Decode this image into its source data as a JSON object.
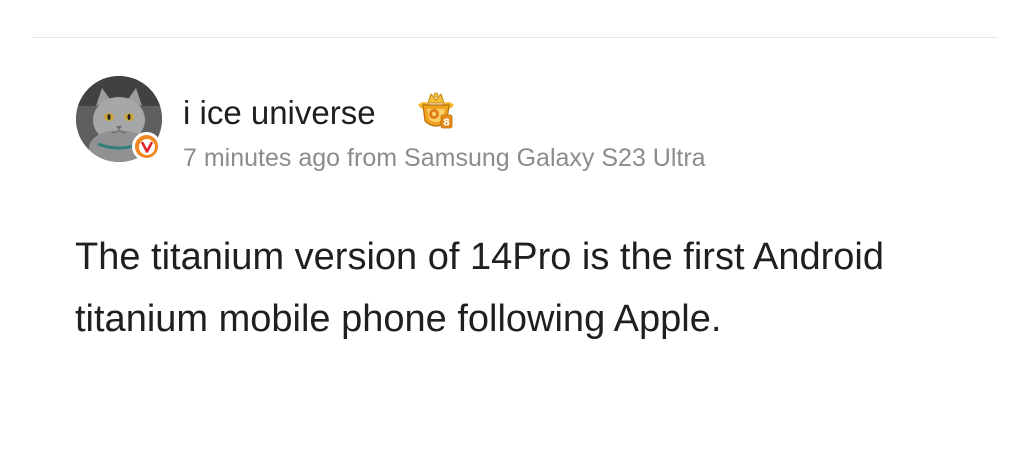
{
  "post": {
    "author": {
      "name": "i ice universe",
      "avatar_icon": "cat-avatar-icon",
      "badge_icon": "verified-v-icon",
      "badge_letter": "V",
      "badge_color": "#f2861f",
      "rank_icon": "crown-rank-icon",
      "rank_letter": "8"
    },
    "time_ago": "7 minutes ago",
    "source_prefix": "from",
    "device": "Samsung Galaxy S23 Ultra",
    "text": "The titanium version of 14Pro is the first Android titanium mobile phone following Apple."
  },
  "colors": {
    "text": "#1f1f1f",
    "meta": "#8c8c8c",
    "divider": "#e6e6e6"
  }
}
